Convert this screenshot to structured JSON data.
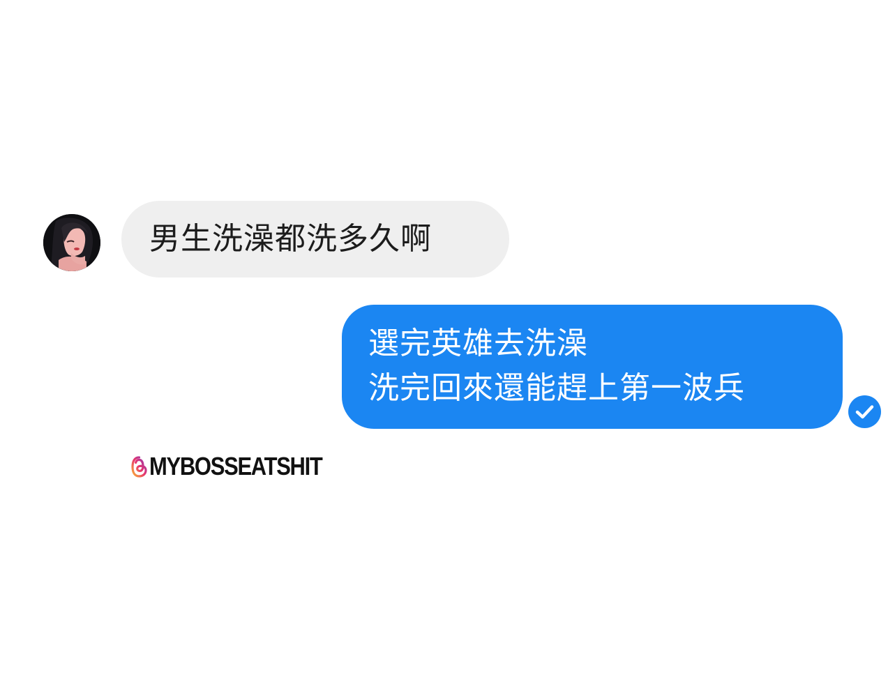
{
  "conversation": {
    "incoming": {
      "avatar_icon": "woman-portrait-avatar",
      "text": "男生洗澡都洗多久啊"
    },
    "outgoing": {
      "lines": [
        "選完英雄去洗澡",
        "洗完回來還能趕上第一波兵"
      ],
      "status_icon": "check-circle-icon"
    }
  },
  "watermark": {
    "icon": "threads-logo-icon",
    "handle": "MYBOSSEATSHIT"
  },
  "colors": {
    "incoming_bubble": "#efefef",
    "outgoing_bubble": "#1b86f2",
    "seen_check": "#1b86f2",
    "background": "#ffffff"
  }
}
